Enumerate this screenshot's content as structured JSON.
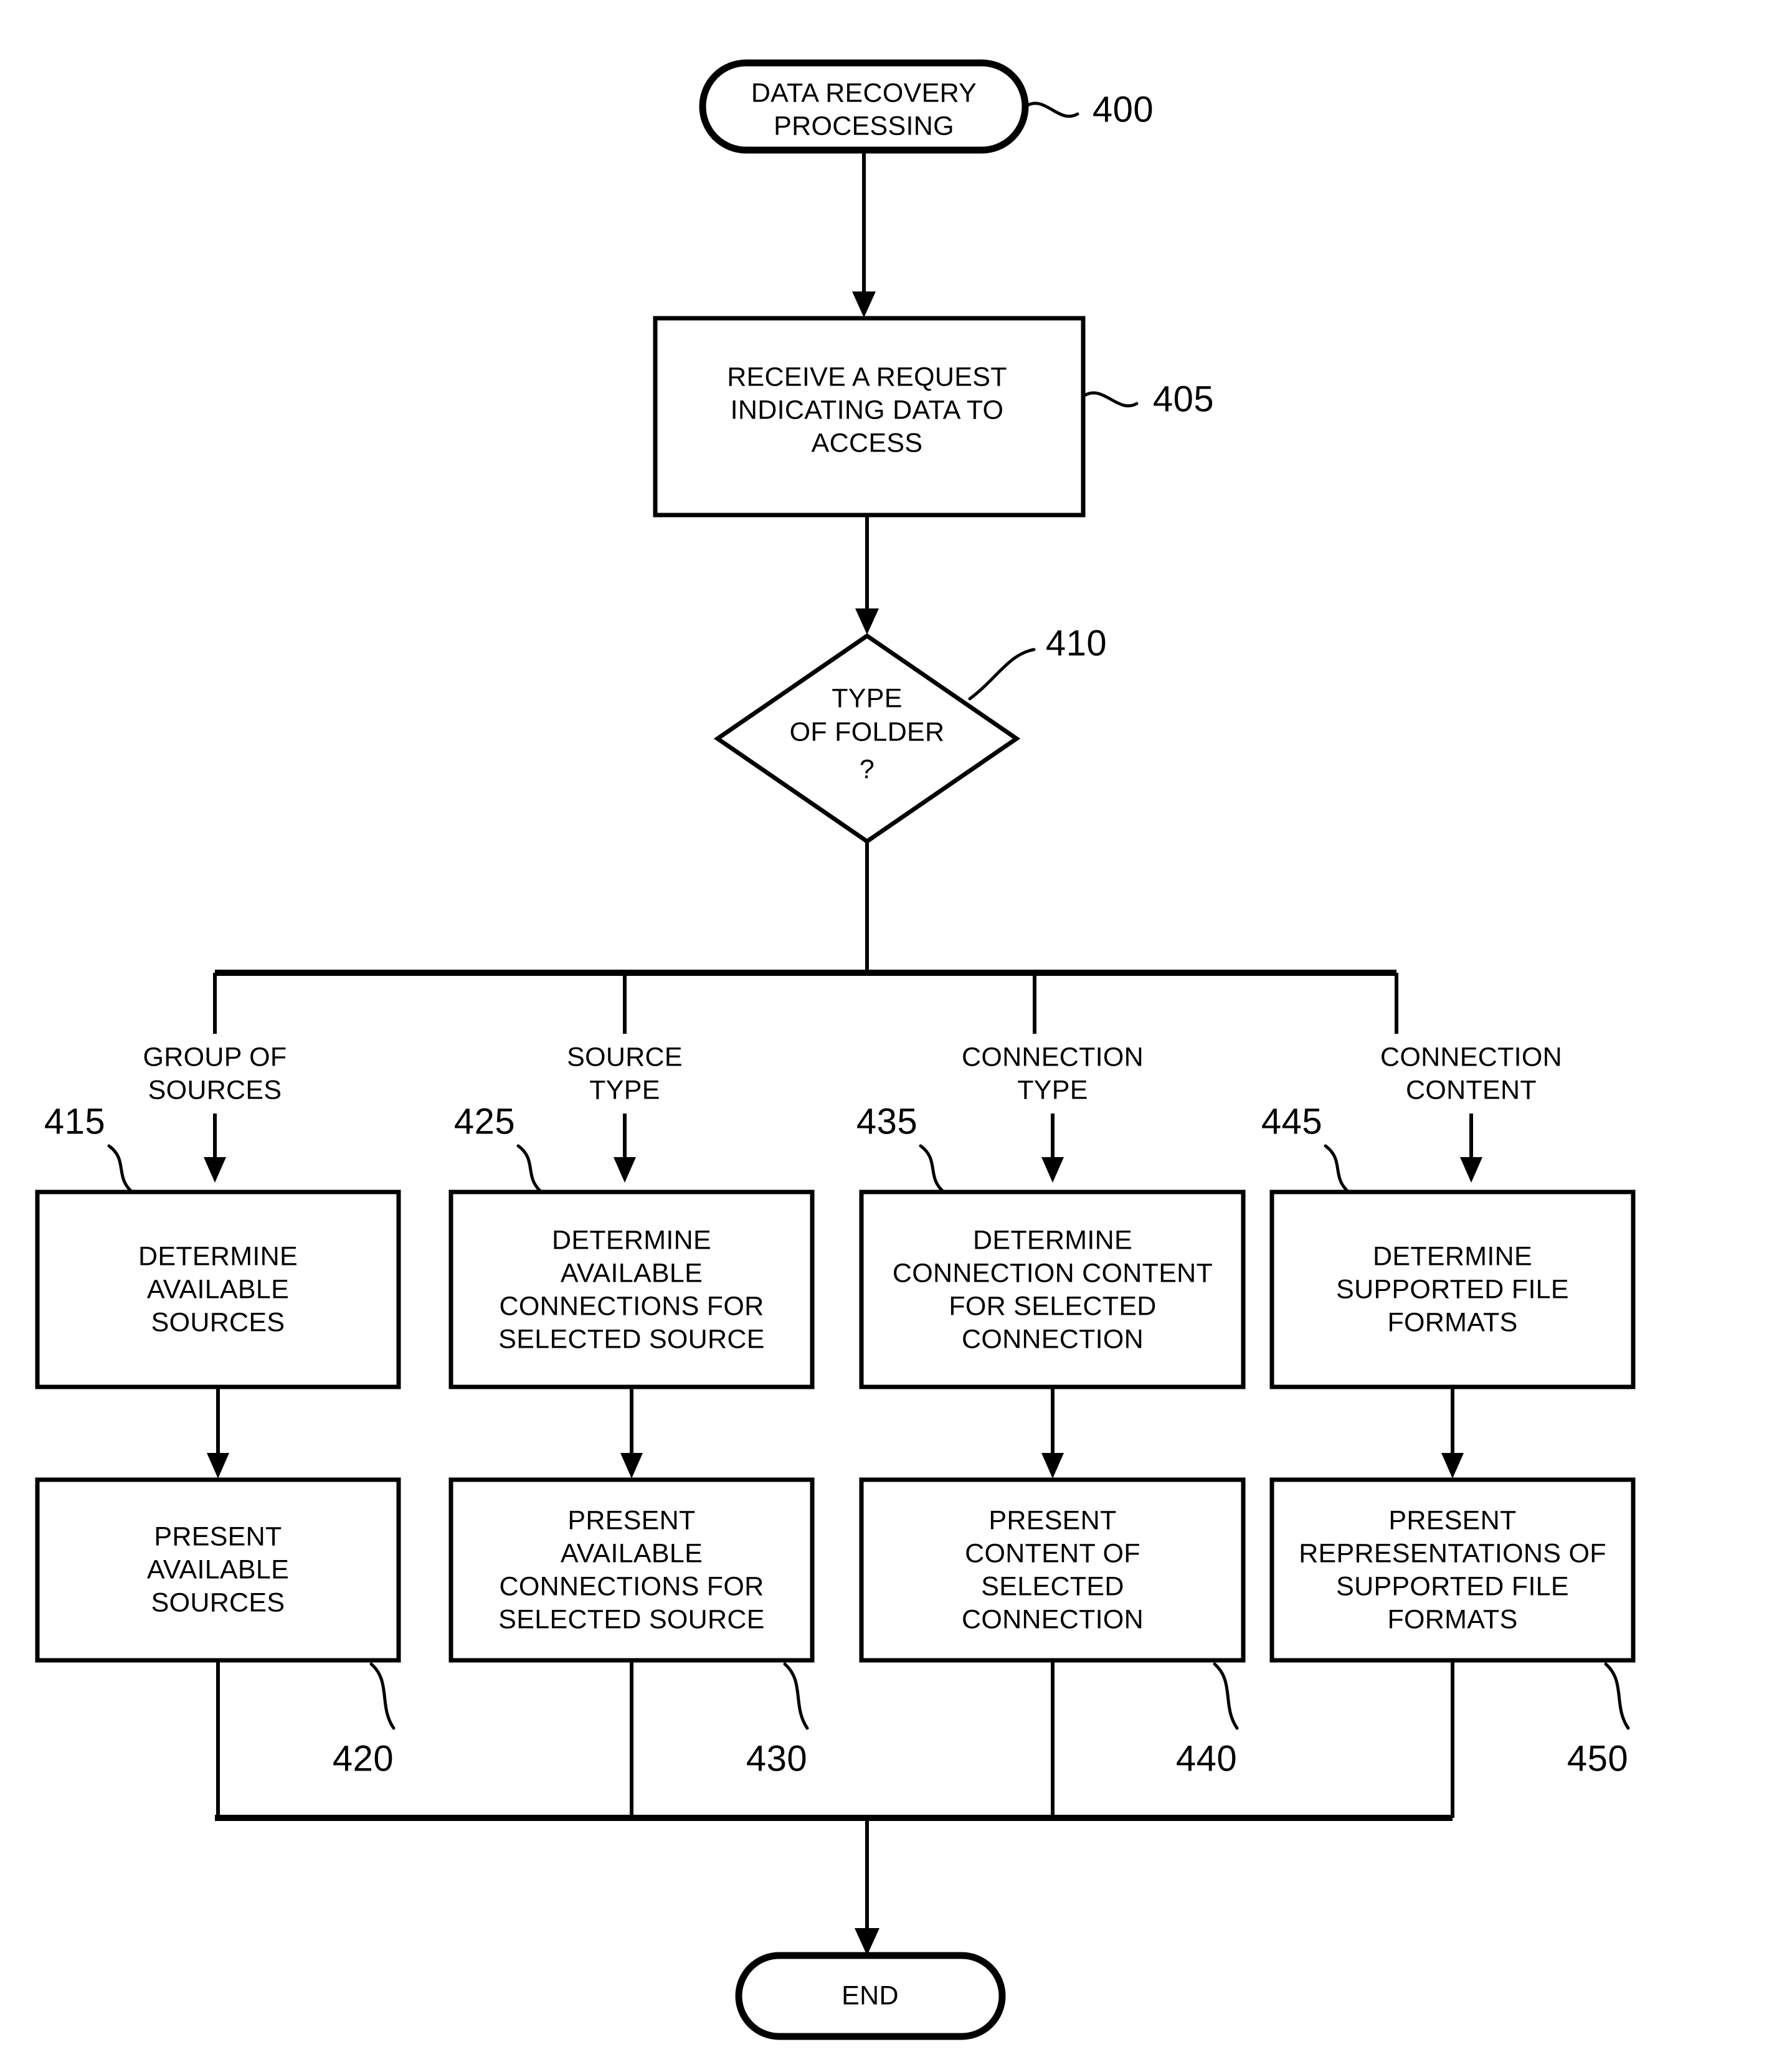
{
  "figure": {
    "type": "flowchart",
    "title": "DATA RECOVERY PROCESSING",
    "background": "#ffffff",
    "line_color": "#000000"
  },
  "nodes": {
    "start": {
      "shape": "terminator",
      "line1": "DATA RECOVERY",
      "line2": "PROCESSING",
      "ref": "400"
    },
    "receive": {
      "shape": "process",
      "line1": "RECEIVE A REQUEST",
      "line2": "INDICATING DATA TO",
      "line3": "ACCESS",
      "ref": "405"
    },
    "decision": {
      "shape": "decision",
      "line1": "TYPE",
      "line2": "OF FOLDER",
      "line3": "?",
      "ref": "410"
    },
    "end": {
      "shape": "terminator",
      "label": "END"
    }
  },
  "branches": [
    {
      "branch_label_line1": "GROUP OF",
      "branch_label_line2": "SOURCES",
      "determine": {
        "ref": "415",
        "lines": [
          "DETERMINE",
          "AVAILABLE",
          "SOURCES"
        ]
      },
      "present": {
        "ref": "420",
        "lines": [
          "PRESENT",
          "AVAILABLE",
          "SOURCES"
        ]
      }
    },
    {
      "branch_label_line1": "SOURCE",
      "branch_label_line2": "TYPE",
      "determine": {
        "ref": "425",
        "lines": [
          "DETERMINE",
          "AVAILABLE",
          "CONNECTIONS FOR",
          "SELECTED SOURCE"
        ]
      },
      "present": {
        "ref": "430",
        "lines": [
          "PRESENT",
          "AVAILABLE",
          "CONNECTIONS FOR",
          "SELECTED SOURCE"
        ]
      }
    },
    {
      "branch_label_line1": "CONNECTION",
      "branch_label_line2": "TYPE",
      "determine": {
        "ref": "435",
        "lines": [
          "DETERMINE",
          "CONNECTION CONTENT",
          "FOR SELECTED",
          "CONNECTION"
        ]
      },
      "present": {
        "ref": "440",
        "lines": [
          "PRESENT",
          "CONTENT OF",
          "SELECTED",
          "CONNECTION"
        ]
      }
    },
    {
      "branch_label_line1": "CONNECTION",
      "branch_label_line2": "CONTENT",
      "determine": {
        "ref": "445",
        "lines": [
          "DETERMINE",
          "SUPPORTED FILE",
          "FORMATS"
        ]
      },
      "present": {
        "ref": "450",
        "lines": [
          "PRESENT",
          "REPRESENTATIONS OF",
          "SUPPORTED FILE",
          "FORMATS"
        ]
      }
    }
  ]
}
